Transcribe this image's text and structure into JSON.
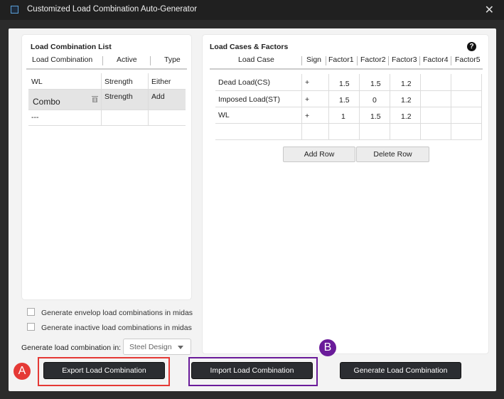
{
  "window": {
    "title": "Customized Load Combination Auto-Generator",
    "close_glyph": "✕"
  },
  "left": {
    "title": "Load Combination List",
    "headers": [
      "Load Combination",
      "Active",
      "Type"
    ],
    "rows": [
      {
        "name": "WL",
        "active": "Strength",
        "type": "Either"
      },
      {
        "name": "Combo",
        "active": "Strength",
        "type": "Add"
      },
      {
        "name": "---",
        "active": "",
        "type": ""
      }
    ],
    "options": [
      "Generate envelop load combinations in midas",
      "Generate inactive load combinations in midas"
    ],
    "gen_in_label": "Generate load combination in:",
    "gen_in_value": "Steel Design"
  },
  "right": {
    "title": "Load Cases & Factors",
    "help": "?",
    "headers": [
      "Load Case",
      "Sign",
      "Factor1",
      "Factor2",
      "Factor3",
      "Factor4",
      "Factor5"
    ],
    "rows": [
      {
        "case": "Dead Load(CS)",
        "sign": "+",
        "f1": "1.5",
        "f2": "1.5",
        "f3": "1.2",
        "f4": "",
        "f5": ""
      },
      {
        "case": "Imposed Load(ST)",
        "sign": "+",
        "f1": "1.5",
        "f2": "0",
        "f3": "1.2",
        "f4": "",
        "f5": ""
      },
      {
        "case": "WL",
        "sign": "+",
        "f1": "1",
        "f2": "1.5",
        "f3": "1.2",
        "f4": "",
        "f5": ""
      },
      {
        "case": "",
        "sign": "",
        "f1": "",
        "f2": "",
        "f3": "",
        "f4": "",
        "f5": ""
      }
    ],
    "add_row": "Add Row",
    "delete_row": "Delete Row"
  },
  "footer": {
    "export": "Export Load Combination",
    "import": "Import Load Combination",
    "generate": "Generate Load Combination"
  },
  "annotations": {
    "a": {
      "label": "A",
      "color": "#e53935"
    },
    "b": {
      "label": "B",
      "color": "#6a1b9a"
    }
  }
}
